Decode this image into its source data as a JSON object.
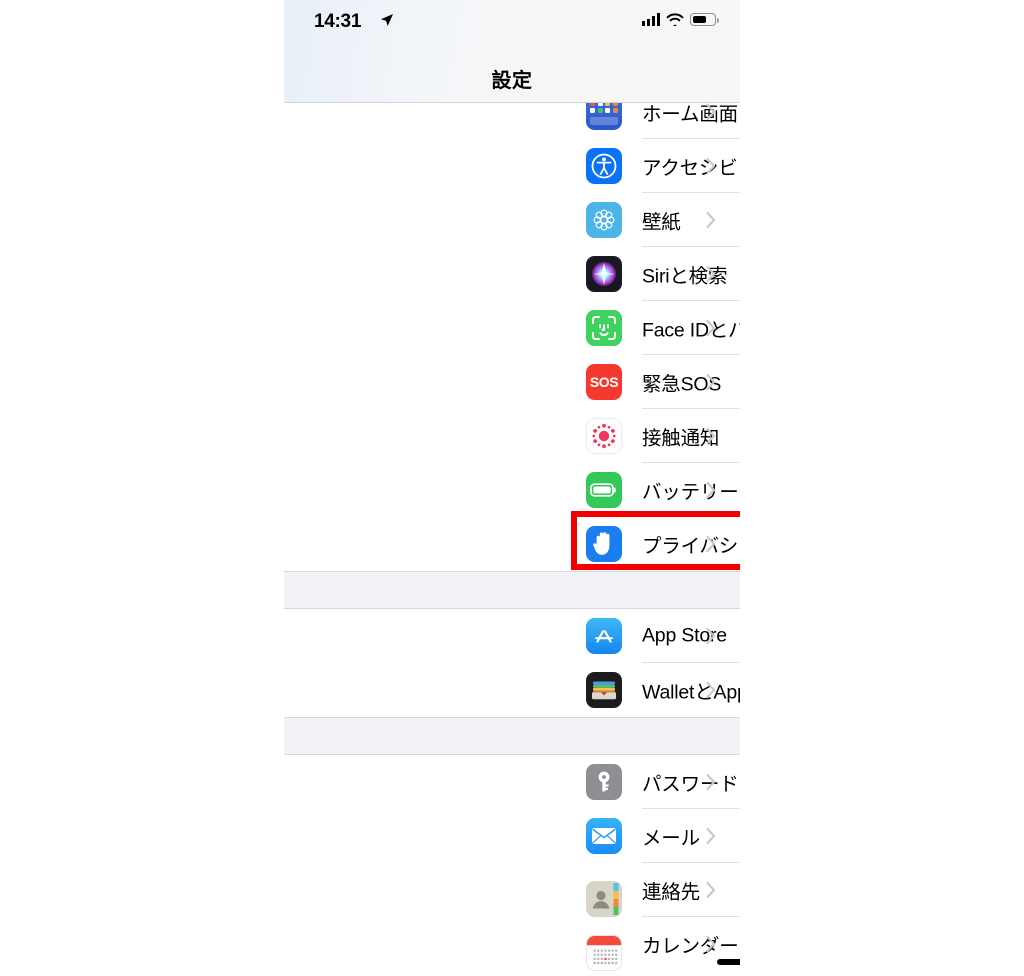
{
  "statusbar": {
    "time": "14:31",
    "location_icon": "location-arrow-icon",
    "cellular_icon": "cellular-bars-icon",
    "wifi_icon": "wifi-icon",
    "battery_icon": "battery-icon"
  },
  "navbar": {
    "title": "設定"
  },
  "annotation": {
    "color": "#f50000",
    "target": "プライバシー"
  },
  "list": {
    "groups": [
      {
        "rows": [
          {
            "label": "ホーム画面",
            "icon": "home-screen-icon",
            "chevron": "chevron-right-icon",
            "partial": true
          },
          {
            "label": "アクセシビリティ",
            "icon": "accessibility-icon",
            "chevron": "chevron-right-icon"
          },
          {
            "label": "壁紙",
            "icon": "wallpaper-icon",
            "chevron": "chevron-right-icon"
          },
          {
            "label": "Siriと検索",
            "icon": "siri-icon",
            "chevron": "chevron-right-icon"
          },
          {
            "label": "Face IDとパスコード",
            "icon": "face-id-icon",
            "chevron": "chevron-right-icon"
          },
          {
            "label": "緊急SOS",
            "icon": "emergency-sos-icon",
            "chevron": "chevron-right-icon"
          },
          {
            "label": "接触通知",
            "icon": "exposure-notifications-icon",
            "chevron": "chevron-right-icon"
          },
          {
            "label": "バッテリー",
            "icon": "battery-settings-icon",
            "chevron": "chevron-right-icon"
          },
          {
            "label": "プライバシー",
            "icon": "privacy-hand-icon",
            "chevron": "chevron-right-icon",
            "highlighted": true
          }
        ]
      },
      {
        "rows": [
          {
            "label": "App Store",
            "icon": "app-store-icon",
            "chevron": "chevron-right-icon"
          },
          {
            "label": "WalletとApple Pay",
            "icon": "wallet-icon",
            "chevron": "chevron-right-icon"
          }
        ]
      },
      {
        "rows": [
          {
            "label": "パスワード",
            "icon": "passwords-key-icon",
            "chevron": "chevron-right-icon"
          },
          {
            "label": "メール",
            "icon": "mail-icon",
            "chevron": "chevron-right-icon"
          },
          {
            "label": "連絡先",
            "icon": "contacts-icon",
            "chevron": "chevron-right-icon"
          },
          {
            "label": "カレンダー",
            "icon": "calendar-icon",
            "chevron": "chevron-right-icon"
          }
        ]
      }
    ]
  },
  "scrollbar": {
    "name": "vertical-scroll-indicator"
  },
  "home_indicator": {
    "name": "home-indicator"
  },
  "colors": {
    "group_gap": "#f2f2f7",
    "separator": "#e2e2e4",
    "chevron": "#c7c7cc",
    "annotation_red": "#f50000"
  }
}
